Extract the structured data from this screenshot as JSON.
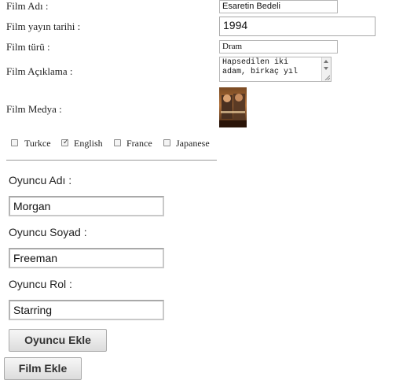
{
  "film_form": {
    "name_label": "Film Adı :",
    "name_value": "Esaretin Bedeli",
    "release_label": "Film yayın tarihi :",
    "release_value": "1994",
    "genre_label": "Film türü :",
    "genre_value": "Dram",
    "description_label": "Film Açıklama :",
    "description_value": "Hapsedilen iki\nadam, birkaç yıl",
    "media_label": "Film Medya :",
    "languages": [
      {
        "label": "Turkce",
        "checked": false
      },
      {
        "label": "English",
        "checked": true
      },
      {
        "label": "France",
        "checked": false
      },
      {
        "label": "Japanese",
        "checked": false
      }
    ]
  },
  "actor_form": {
    "first_name_label": "Oyuncu Adı :",
    "first_name_value": "Morgan",
    "last_name_label": "Oyuncu Soyad :",
    "last_name_value": "Freeman",
    "role_label": "Oyuncu Rol :",
    "role_value": "Starring",
    "add_actor_button": "Oyuncu Ekle"
  },
  "add_film_button": "Film Ekle"
}
